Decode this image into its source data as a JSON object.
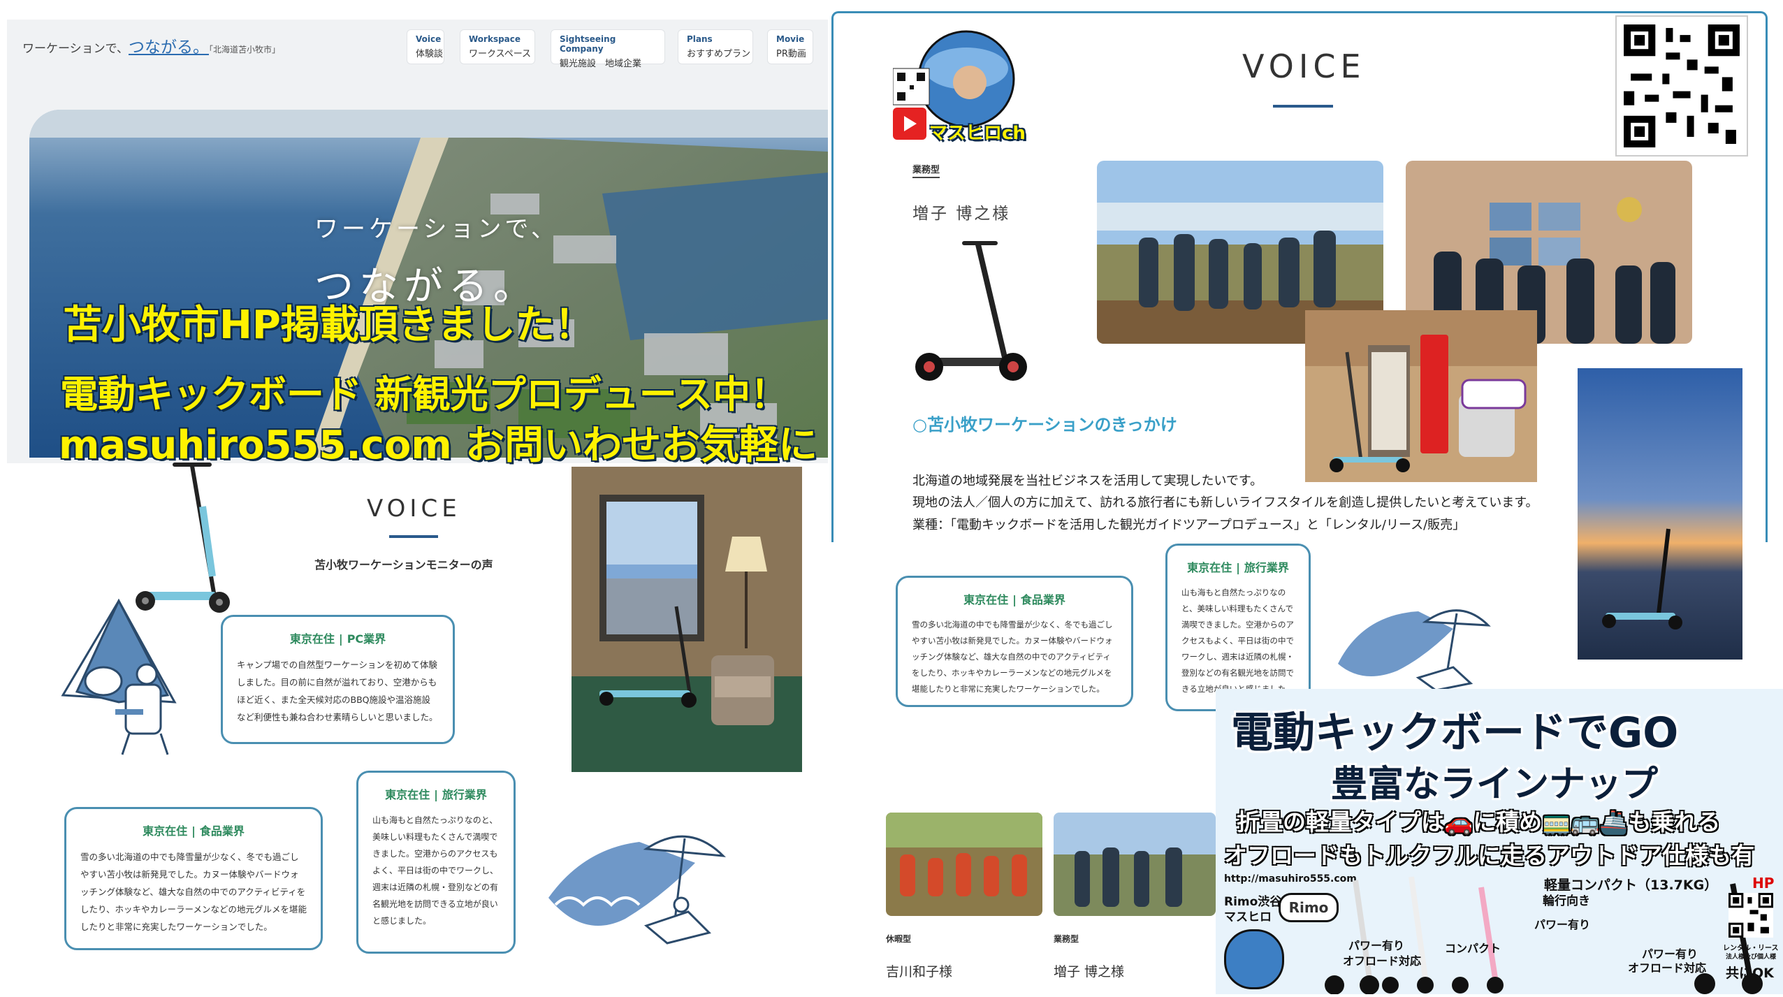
{
  "site": {
    "tagline_prefix": "ワーケーションで、",
    "tagline_link": "つながる。",
    "tagline_region": "「北海道苫小牧市」",
    "nav": [
      {
        "en": "Voice",
        "ja": "体験談"
      },
      {
        "en": "Workspace",
        "ja": "ワークスペース"
      },
      {
        "en": "Sightseeing Company",
        "ja": "観光施設　地域企業"
      },
      {
        "en": "Plans",
        "ja": "おすすめプラン"
      },
      {
        "en": "Movie",
        "ja": "PR動画"
      }
    ],
    "hero_line1": "ワーケーションで、",
    "hero_line2": "つながる。"
  },
  "overlay": {
    "line1": "苫小牧市HP掲載頂きました！",
    "line2": "電動キックボード 新観光プロデュース中！",
    "line3": "masuhiro555.com お問いわせお気軽に"
  },
  "left_voice": {
    "title": "VOICE",
    "subtitle": "苫小牧ワーケーションモニターの声",
    "cards": [
      {
        "place": "東京在住",
        "industry": "PC業界",
        "text": "キャンプ場での自然型ワーケーションを初めて体験しました。目の前に自然が溢れており、空港からもほど近く、また全天候対応のBBQ施設や温浴施設など利便性も兼ね合わせ素晴らしいと思いました。"
      },
      {
        "place": "東京在住",
        "industry": "旅行業界",
        "text": "山も海もと自然たっぷりなのと、美味しい料理もたくさんで満喫できました。空港からのアクセスもよく、平日は街の中でワークし、週末は近隣の札幌・登別などの有名観光地を訪問できる立地が良いと感じました。"
      },
      {
        "place": "東京在住",
        "industry": "食品業界",
        "text": "雪の多い北海道の中でも降雪量が少なく、冬でも過ごしやすい苫小牧は新発見でした。カヌー体験やバードウォッチング体験など、雄大な自然の中でのアクティビティをしたり、ホッキやカレーラーメンなどの地元グルメを堪能したりと非常に充実したワーケーションでした。"
      }
    ]
  },
  "right_voice": {
    "title": "VOICE",
    "channel": "マスヒロch",
    "type_label": "業務型",
    "name": "増子 博之様",
    "kikkake": "○苫小牧ワーケーションのきっかけ",
    "lines": [
      "北海道の地域発展を当社ビジネスを活用して実現したいです。",
      "現地の法人／個人の方に加えて、訪れる旅行者にも新しいライフスタイルを創造し提供したいと考えています。",
      "業種：「電動キックボードを活用した観光ガイドツアープロデュース」と「レンタル/リース/販売」"
    ],
    "cards": [
      {
        "place": "東京在住",
        "industry": "食品業界",
        "text": "雪の多い北海道の中でも降雪量が少なく、冬でも過ごしやすい苫小牧は新発見でした。カヌー体験やバードウォッチング体験など、雄大な自然の中でのアクティビティをしたり、ホッキやカレーラーメンなどの地元グルメを堪能したりと非常に充実したワーケーションでした。"
      },
      {
        "place": "東京在住",
        "industry": "旅行業界",
        "text": "山も海もと自然たっぷりなのと、美味しい料理もたくさんで満喫できました。空港からのアクセスもよく、平日は街の中でワークし、週末は近隣の札幌・登別などの有名観光地を訪問できる立地が良いと感じました。"
      }
    ],
    "bottom": [
      {
        "type": "休暇型",
        "name": "吉川和子様"
      },
      {
        "type": "業務型",
        "name": "増子 博之様"
      }
    ]
  },
  "promo": {
    "title1": "電動キックボードでGO",
    "title2": "豊富なラインナップ",
    "line1": "折畳の軽量タイプは🚗に積め🚃🚌🚢も乗れる",
    "line2": "オフロードもトルクフルに走るアウトドア仕様も有",
    "url": "http://masuhiro555.com",
    "brand1": "Rimo渋谷",
    "brand2": "マスヒロ",
    "logo": "Rimo",
    "label_a": "軽量コンパクト（13.7KG）",
    "label_b": "輪行向き",
    "label_c": "パワー有り",
    "label_d": "コンパクト",
    "label_e": "パワー有り",
    "label_f": "オフロード対応",
    "label_g": "パワー有り",
    "label_h": "オフロード対応",
    "hp": "HP",
    "rental": "レンタル・リース",
    "rental2": "法人様及び個人様",
    "ok": "共にOK"
  },
  "colors": {
    "accent": "#3a8db7",
    "green": "#2e8a5e",
    "yellow": "#fff200",
    "navy": "#2a5a8c"
  }
}
